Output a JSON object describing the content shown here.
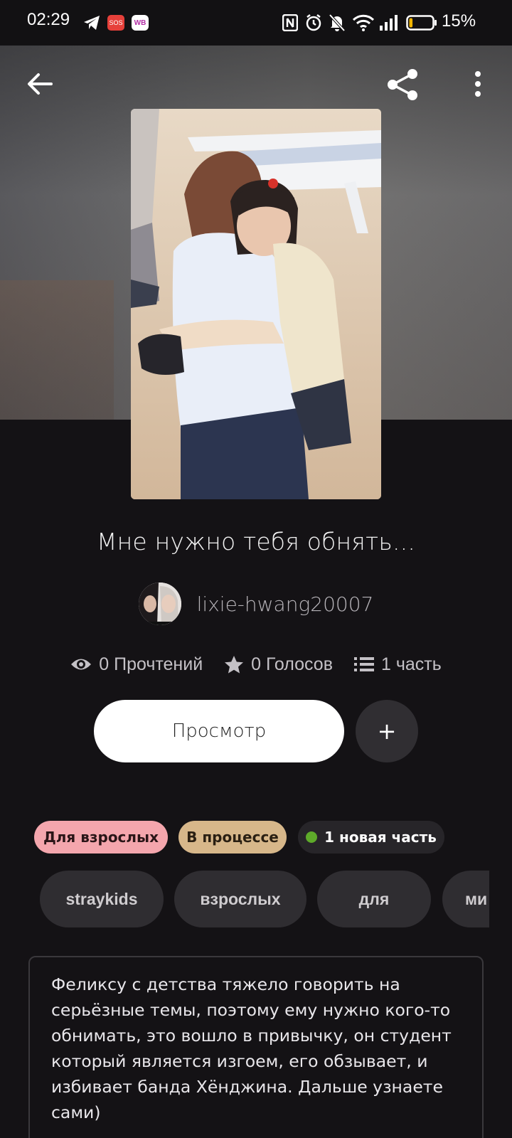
{
  "status_bar": {
    "time": "02:29",
    "sos_label": "SOS",
    "wb_label": "WB",
    "battery_percent": "15%",
    "battery_level": 0.15,
    "icons": [
      "telegram-icon",
      "sos-icon",
      "wb-icon",
      "nfc-icon",
      "alarm-icon",
      "mute-icon",
      "wifi-icon",
      "signal-icon",
      "battery-icon"
    ]
  },
  "header": {
    "back_icon": "arrow-left-icon",
    "share_icon": "share-icon",
    "more_icon": "more-vertical-icon"
  },
  "story": {
    "title": "Мне нужно тебя обнять...",
    "author": "lixie-hwang20007",
    "stats": {
      "reads": "0 Прочтений",
      "votes": "0 Голосов",
      "parts": "1 часть"
    },
    "read_button": "Просмотр",
    "add_button": "+",
    "badges": {
      "mature": "Для взрослых",
      "ongoing": "В процессе",
      "new_part": "1 новая часть"
    },
    "tags": [
      "straykids",
      "взрослых",
      "для",
      "ми"
    ],
    "description": "Феликсу с детства тяжело говорить на серьёзные темы, поэтому ему нужно кого-то обнимать, это вошло в привычку, он студент который является изгоем, его обзывает, и избивает банда Хёнджина. Дальше узнаете сами)"
  },
  "colors": {
    "background": "#141215",
    "mature_badge": "#f4a6ad",
    "ongoing_badge": "#d7b78a",
    "new_dot": "#5eaa2a",
    "tag_bg": "#2f2d31"
  }
}
